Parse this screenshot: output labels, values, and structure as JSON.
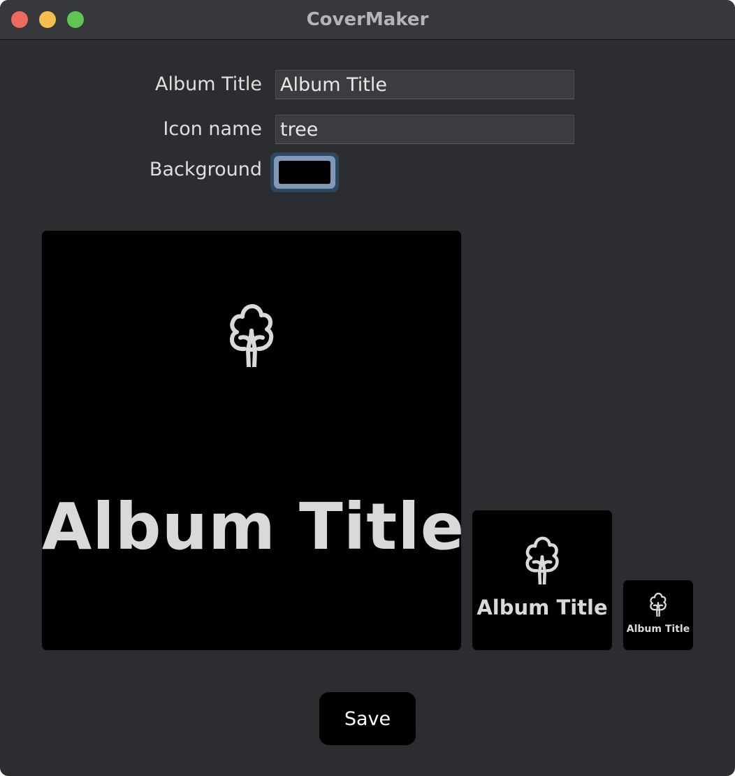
{
  "window": {
    "title": "CoverMaker"
  },
  "form": {
    "album_title_label": "Album Title",
    "album_title_value": "Album Title",
    "icon_name_label": "Icon name",
    "icon_name_value": "tree",
    "background_label": "Background",
    "background_color": "#000000"
  },
  "previews": {
    "icon": "tree-icon",
    "title_text": "Album Title",
    "text_color": "#d9d9d9",
    "items": [
      {
        "title": "Album Title"
      },
      {
        "title": "Album Title"
      },
      {
        "title": "Album Title"
      }
    ]
  },
  "actions": {
    "save_label": "Save"
  }
}
